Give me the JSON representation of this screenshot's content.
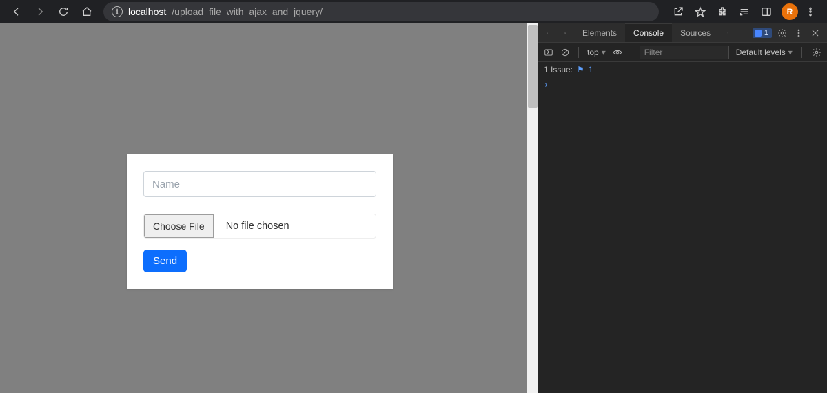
{
  "browser": {
    "host": "localhost",
    "path": "/upload_file_with_ajax_and_jquery/",
    "avatar_initial": "R"
  },
  "form": {
    "name_placeholder": "Name",
    "name_value": "",
    "choose_file_label": "Choose File",
    "file_status": "No file chosen",
    "send_label": "Send"
  },
  "devtools": {
    "tabs": {
      "elements": "Elements",
      "console": "Console",
      "sources": "Sources"
    },
    "tabs_badge_count": "1",
    "context_scope": "top",
    "filter_placeholder": "Filter",
    "levels_label": "Default levels",
    "issues_prefix": "1 Issue:",
    "issues_count": "1",
    "prompt": "›"
  }
}
